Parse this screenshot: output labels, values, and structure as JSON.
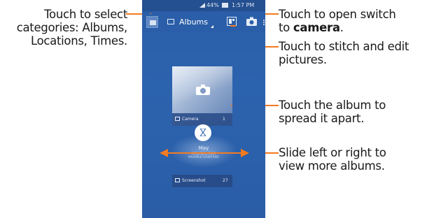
{
  "callouts": {
    "select_categories": "Touch to select categories: Albums, Locations, Times.",
    "select_line1": "Touch to select",
    "select_line2": "categories: Albums,",
    "select_line3": "Locations, Times.",
    "camera_prefix": "Touch to open switch",
    "camera_to": "to ",
    "camera_bold": "camera",
    "camera_period": ".",
    "stitch_line1": "Touch to stitch and edit",
    "stitch_line2": "pictures.",
    "spread_line1": "Touch the album to",
    "spread_line2": "spread it apart.",
    "slide_line1": "Slide left or right to",
    "slide_line2": "view more albums."
  },
  "status_bar": {
    "battery_percent": "44%",
    "time": "1:57 PM"
  },
  "action_bar": {
    "category_label": "Albums"
  },
  "albums": [
    {
      "name": "Camera",
      "count": "1"
    },
    {
      "name": "Screenshot",
      "count": "27"
    }
  ],
  "date_group": {
    "month": "May",
    "sub_line1": "2014, 5pm, 2015",
    "sub_line2": "MULTIPLE COUNTRIES"
  },
  "colors": {
    "leader": "#f47a20",
    "phone_bg": "#2c63ae",
    "text": "#1a1a1a"
  },
  "icons": [
    "gallery-select-icon",
    "folder-icon",
    "stitch-icon",
    "camera-icon",
    "hourglass-icon"
  ]
}
